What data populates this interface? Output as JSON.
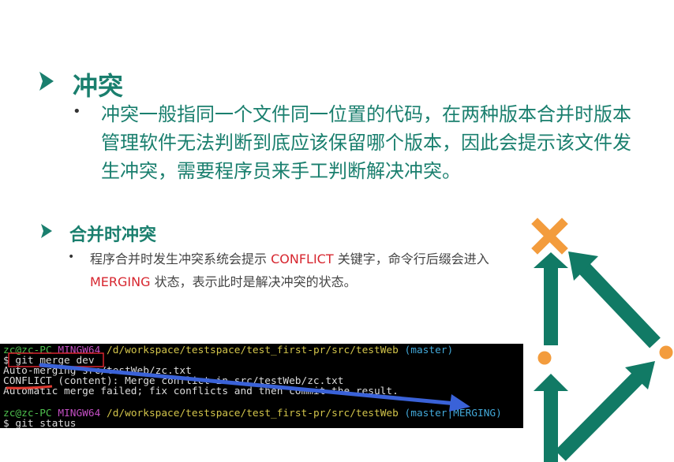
{
  "section1": {
    "title": "冲突",
    "body": "冲突一般指同一个文件同一位置的代码，在两种版本合并时版本管理软件无法判断到底应该保留哪个版本，因此会提示该文件发生冲突，需要程序员来手工判断解决冲突。"
  },
  "section2": {
    "title": "合并时冲突",
    "text_before": "程序合并时发生冲突系统会提示 ",
    "kw1": "CONFLICT",
    "text_mid": " 关键字，命令行后缀会进入 ",
    "kw2": "MERGING",
    "text_after": " 状态，表示此时是解决冲突的状态。"
  },
  "terminal": {
    "line1": {
      "user": "zc@zc-PC",
      "env": "MINGW64",
      "path": "/d/workspace/testspace/test_first-pr/src/testWeb",
      "branch": "(master)"
    },
    "line2": "$ git merge dev",
    "line3": "Auto-merging src/testWeb/zc.txt",
    "line4": "CONFLICT (content): Merge conflict in src/testWeb/zc.txt",
    "line5": "Automatic merge failed; fix conflicts and then commit the result.",
    "line6": {
      "user": "zc@zc-PC",
      "env": "MINGW64",
      "path": "/d/workspace/testspace/test_first-pr/src/testWeb",
      "branch": "(master|MERGING)"
    },
    "line7": "$ git status"
  },
  "colors": {
    "heading": "#1a7f6e",
    "keyword": "#d7262f",
    "diagram_arrow": "#117a65",
    "conflict_x": "#f39c3d",
    "annotation_arrow": "#3a62d8"
  },
  "diagram": {
    "icons": [
      "cross-x-icon",
      "merge-arrow-icon",
      "commit-node-icon"
    ]
  }
}
